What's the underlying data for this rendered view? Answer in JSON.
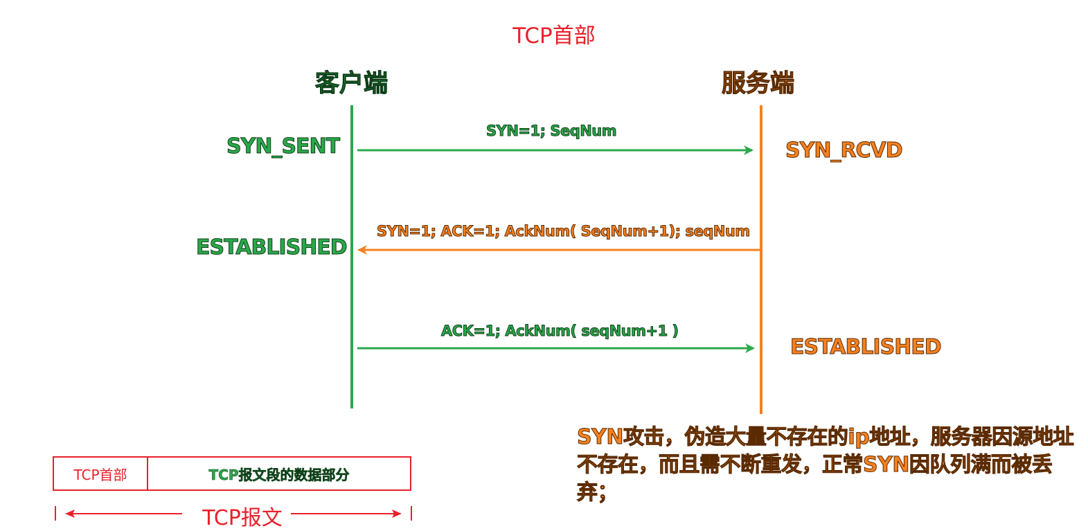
{
  "title": "TCP首部",
  "client": {
    "label": "客户端",
    "states": [
      "SYN_SENT",
      "ESTABLISHED"
    ],
    "color": "#2aa84a"
  },
  "server": {
    "label": "服务端",
    "states": [
      "SYN_RCVD",
      "ESTABLISHED"
    ],
    "color": "#f58020"
  },
  "messages": [
    {
      "text": "SYN=1; SeqNum",
      "direction": "client-to-server"
    },
    {
      "text": "SYN=1; ACK=1; AckNum( SeqNum+1); seqNum",
      "direction": "server-to-client"
    },
    {
      "text": "ACK=1; AckNum( seqNum+1 )",
      "direction": "client-to-server"
    }
  ],
  "note": "SYN攻击，伪造大量不存在的ip地址，服务器因源地址不存在，而且需不断重发，正常SYN因队列满而被丢弃；",
  "packet": {
    "header_label": "TCP首部",
    "data_label": "TCP报文段的数据部分",
    "total_label": "TCP报文"
  }
}
